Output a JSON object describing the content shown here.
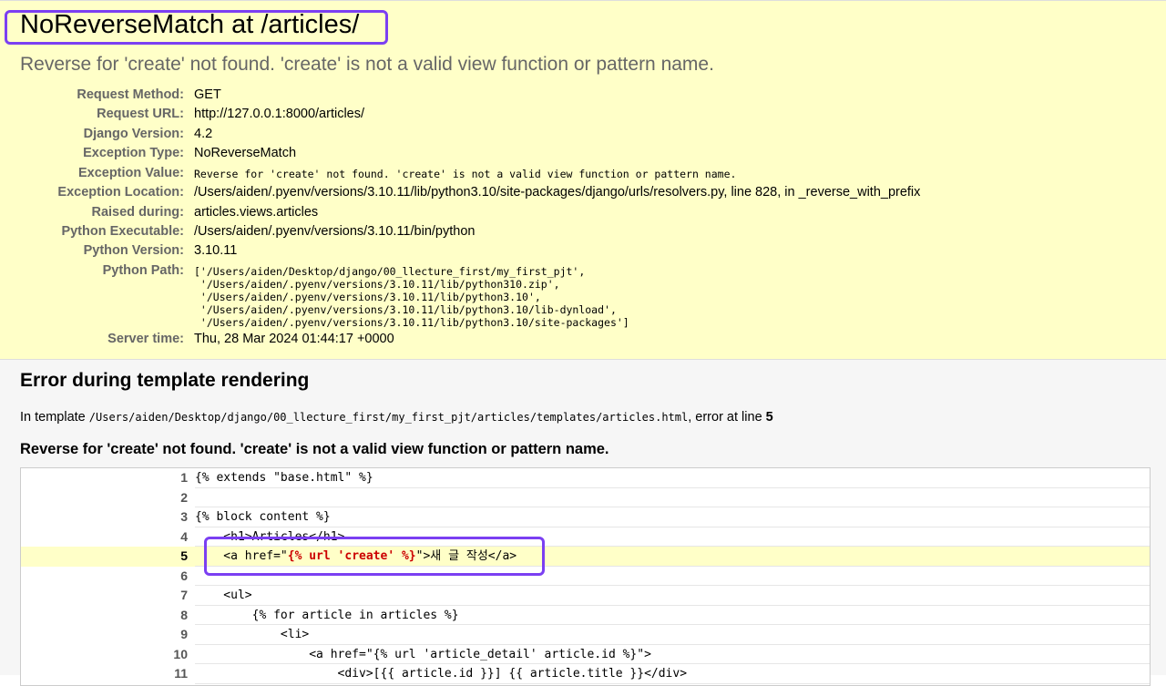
{
  "header": {
    "title": "NoReverseMatch at /articles/",
    "subtitle": "Reverse for 'create' not found. 'create' is not a valid view function or pattern name."
  },
  "meta": [
    {
      "label": "Request Method:",
      "value": "GET"
    },
    {
      "label": "Request URL:",
      "value": "http://127.0.0.1:8000/articles/"
    },
    {
      "label": "Django Version:",
      "value": "4.2"
    },
    {
      "label": "Exception Type:",
      "value": "NoReverseMatch"
    },
    {
      "label": "Exception Value:",
      "value": "Reverse for 'create' not found. 'create' is not a valid view function or pattern name."
    },
    {
      "label": "Exception Location:",
      "value": "/Users/aiden/.pyenv/versions/3.10.11/lib/python3.10/site-packages/django/urls/resolvers.py, line 828, in _reverse_with_prefix"
    },
    {
      "label": "Raised during:",
      "value": "articles.views.articles"
    },
    {
      "label": "Python Executable:",
      "value": "/Users/aiden/.pyenv/versions/3.10.11/bin/python"
    },
    {
      "label": "Python Version:",
      "value": "3.10.11"
    },
    {
      "label": "Python Path:",
      "lines": [
        "['/Users/aiden/Desktop/django/00_llecture_first/my_first_pjt',",
        " '/Users/aiden/.pyenv/versions/3.10.11/lib/python310.zip',",
        " '/Users/aiden/.pyenv/versions/3.10.11/lib/python3.10',",
        " '/Users/aiden/.pyenv/versions/3.10.11/lib/python3.10/lib-dynload',",
        " '/Users/aiden/.pyenv/versions/3.10.11/lib/python3.10/site-packages']"
      ]
    },
    {
      "label": "Server time:",
      "value": "Thu, 28 Mar 2024 01:44:17 +0000"
    }
  ],
  "template": {
    "heading": "Error during template rendering",
    "info_prefix": "In template",
    "path": "/Users/aiden/Desktop/django/00_llecture_first/my_first_pjt/articles/templates/articles.html",
    "info_middle": ", error at line",
    "error_line": "5",
    "message": "Reverse for 'create' not found. 'create' is not a valid view function or pattern name.",
    "source": [
      {
        "num": "1",
        "code": "{% extends \"base.html\" %}"
      },
      {
        "num": "2",
        "code": ""
      },
      {
        "num": "3",
        "code": "{% block content %}"
      },
      {
        "num": "4",
        "code": "    <h1>Articles</h1>"
      },
      {
        "num": "5",
        "before": "    <a href=\"",
        "error": "{% url 'create' %}",
        "after": "\">새 글 작성</a>",
        "is_error": true
      },
      {
        "num": "6",
        "code": ""
      },
      {
        "num": "7",
        "code": "    <ul>"
      },
      {
        "num": "8",
        "code": "        {% for article in articles %}"
      },
      {
        "num": "9",
        "code": "            <li>"
      },
      {
        "num": "10",
        "code": "                <a href=\"{% url 'article_detail' article.id %}\">"
      },
      {
        "num": "11",
        "code": "                    <div>[{{ article.id }}] {{ article.title }}</div>"
      }
    ]
  },
  "colors": {
    "summary_bg": "#ffffc8",
    "highlight_border": "#7b3ff2",
    "error_token": "#cc0000"
  }
}
